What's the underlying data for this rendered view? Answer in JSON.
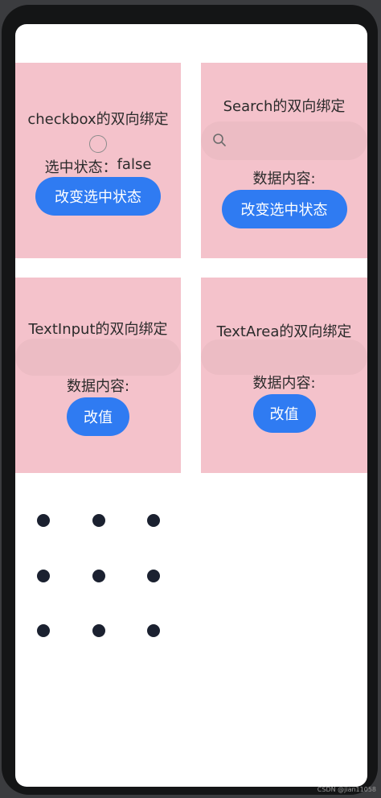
{
  "cards": {
    "checkbox": {
      "title": "checkbox的双向绑定",
      "status_label": "选中状态：",
      "status_value": "false",
      "button_label": "改变选中状态"
    },
    "search": {
      "title": "Search的双向绑定",
      "data_label": "数据内容:",
      "button_label": "改变选中状态"
    },
    "textinput": {
      "title": "TextInput的双向绑定",
      "data_label": "数据内容:",
      "button_label": "改值"
    },
    "textarea": {
      "title": "TextArea的双向绑定",
      "data_label": "数据内容:",
      "button_label": "改值"
    }
  },
  "pattern_lock": {
    "rows": 3,
    "cols": 3
  },
  "watermark": "CSDN @jian11058",
  "colors": {
    "card_bg": "#f4c2cb",
    "button": "#2f7bf2",
    "dot": "#1b2130"
  }
}
